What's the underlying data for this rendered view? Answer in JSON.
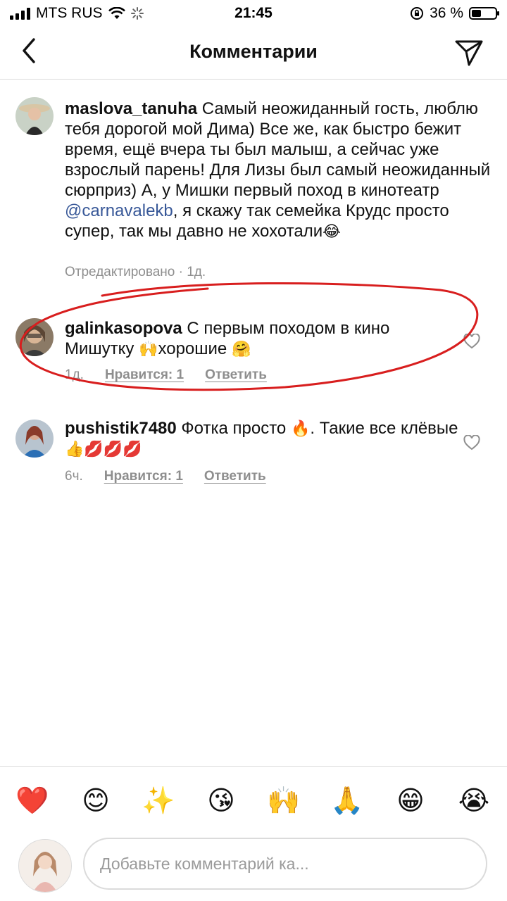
{
  "status_bar": {
    "carrier": "MTS RUS",
    "time": "21:45",
    "battery": "36 %"
  },
  "header": {
    "title": "Комментарии"
  },
  "comments": [
    {
      "username": "maslova_tanuha",
      "text_before": " Самый неожиданный гость, люблю тебя дорогой мой Дима) Все же, как быстро бежит время, ещё вчера ты был малыш, а сейчас уже взрослый парень! Для Лизы был самый неожиданный сюрприз) А, у Мишки первый поход в кинотеатр ",
      "mention": "@carnavalekb",
      "text_after": ", я скажу так семейка Крудс просто супер, так мы давно не хохотали",
      "emoji": "😂",
      "meta": "Отредактировано · 1д."
    },
    {
      "username": "galinkasopova",
      "text_before": " С первым походом в кино Мишутку ",
      "emoji1": "🙌",
      "text_mid": "хорошие ",
      "emoji2": "🤗",
      "time": "1д.",
      "likes": "Нравится: 1",
      "reply": "Ответить"
    },
    {
      "username": "pushistik7480",
      "text_before": " Фотка просто ",
      "emoji1": "🔥",
      "text_mid": ". Такие все клёвые",
      "emoji2": "👍💋💋💋",
      "time": "6ч.",
      "likes": "Нравится: 1",
      "reply": "Ответить"
    }
  ],
  "quick_emojis": [
    "❤️",
    "😊",
    "✨",
    "😘",
    "🙌",
    "🙏",
    "😁",
    "😭"
  ],
  "composer": {
    "placeholder": "Добавьте комментарий ка..."
  },
  "colors": {
    "accent_mention": "#385898",
    "meta_gray": "#8e8e8e",
    "annotation_red": "#d81e1e"
  }
}
